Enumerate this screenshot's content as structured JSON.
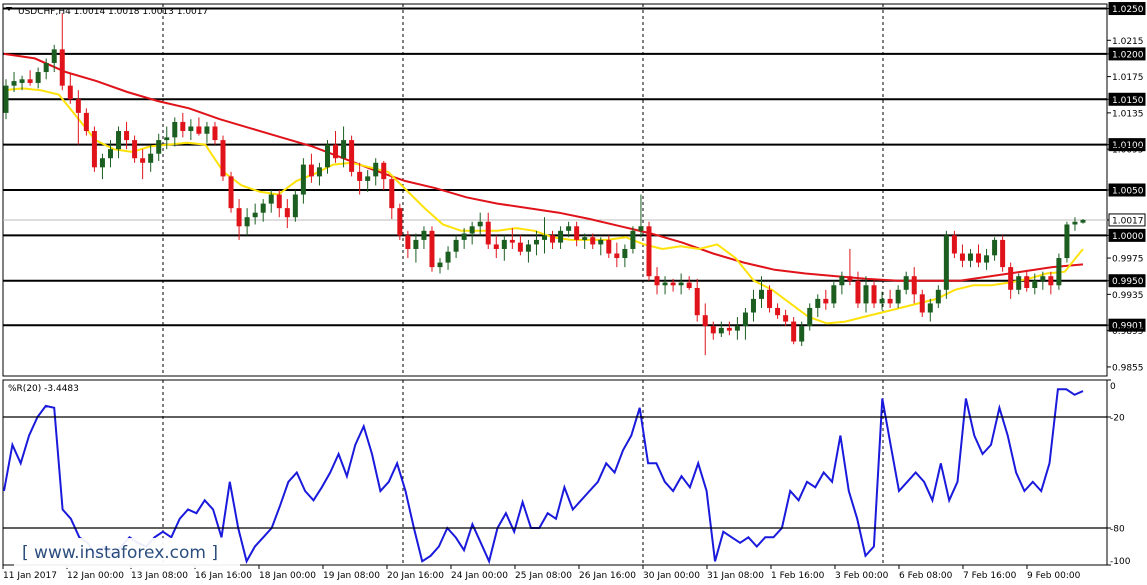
{
  "header": {
    "symbol_line": "USDCHF,H4  1.0014 1.0018 1.0013 1.0017"
  },
  "indicator": {
    "label": "%R(20) -3.4483"
  },
  "watermark": {
    "text": "[ www.instaforex.com ]"
  },
  "colors": {
    "bull": "#1b5e20",
    "bear": "#e0131a",
    "ma_fast": "#ffe20a",
    "ma_slow": "#e0131a",
    "wr": "#1a1adc",
    "level": "#000000"
  },
  "chart_data": [
    {
      "type": "candlestick",
      "title": "USDCHF,H4",
      "ohlc_header": {
        "open": 1.0014,
        "high": 1.0018,
        "low": 1.0013,
        "close": 1.0017
      },
      "ylim": [
        0.9845,
        1.0255
      ],
      "y_ticks": [
        "1.0250",
        "1.0215",
        "1.0200",
        "1.0175",
        "1.0150",
        "1.0135",
        "1.0100",
        "1.0095",
        "1.0050",
        "1.0017",
        "1.0000",
        "0.9975",
        "0.9950",
        "0.9935",
        "0.9901",
        "0.9895",
        "0.9855"
      ],
      "boxed_levels": [
        "1.0250",
        "1.0200",
        "1.0150",
        "1.0100",
        "1.0050",
        "1.0000",
        "0.9950",
        "0.9901"
      ],
      "current_price": "1.0017",
      "x_labels": [
        "11 Jan 2017",
        "12 Jan 00:00",
        "13 Jan 08:00",
        "16 Jan 16:00",
        "18 Jan 00:00",
        "19 Jan 08:00",
        "20 Jan 16:00",
        "24 Jan 00:00",
        "25 Jan 08:00",
        "26 Jan 16:00",
        "30 Jan 00:00",
        "31 Jan 08:00",
        "1 Feb 16:00",
        "3 Feb 00:00",
        "6 Feb 08:00",
        "7 Feb 16:00",
        "9 Feb 00:00"
      ],
      "candles": [
        [
          1.0135,
          1.0172,
          1.0128,
          1.0165
        ],
        [
          1.0165,
          1.018,
          1.0158,
          1.017
        ],
        [
          1.0168,
          1.0176,
          1.016,
          1.0172
        ],
        [
          1.0172,
          1.0182,
          1.0165,
          1.0168
        ],
        [
          1.0168,
          1.0185,
          1.0162,
          1.018
        ],
        [
          1.018,
          1.0195,
          1.0172,
          1.019
        ],
        [
          1.019,
          1.021,
          1.018,
          1.0205
        ],
        [
          1.0205,
          1.0245,
          1.016,
          1.0165
        ],
        [
          1.0165,
          1.0178,
          1.0145,
          1.015
        ],
        [
          1.015,
          1.016,
          1.01,
          1.0135
        ],
        [
          1.0135,
          1.014,
          1.011,
          1.0115
        ],
        [
          1.0115,
          1.012,
          1.007,
          1.0075
        ],
        [
          1.0075,
          1.009,
          1.0062,
          1.0085
        ],
        [
          1.0085,
          1.0105,
          1.0075,
          1.0095
        ],
        [
          1.0095,
          1.012,
          1.0085,
          1.0115
        ],
        [
          1.0115,
          1.0125,
          1.0095,
          1.0105
        ],
        [
          1.0105,
          1.011,
          1.008,
          1.0085
        ],
        [
          1.0085,
          1.0095,
          1.0062,
          1.008
        ],
        [
          1.008,
          1.01,
          1.007,
          1.009
        ],
        [
          1.009,
          1.0112,
          1.0082,
          1.0105
        ],
        [
          1.0105,
          1.012,
          1.0095,
          1.0108
        ],
        [
          1.0108,
          1.013,
          1.0098,
          1.0125
        ],
        [
          1.0125,
          1.0135,
          1.0108,
          1.0115
        ],
        [
          1.0115,
          1.0128,
          1.0105,
          1.012
        ],
        [
          1.012,
          1.013,
          1.011,
          1.0112
        ],
        [
          1.0112,
          1.0125,
          1.0102,
          1.012
        ],
        [
          1.012,
          1.0125,
          1.01,
          1.0105
        ],
        [
          1.0105,
          1.011,
          1.006,
          1.0065
        ],
        [
          1.0065,
          1.007,
          1.0025,
          1.003
        ],
        [
          1.003,
          1.004,
          0.9995,
          1.001
        ],
        [
          1.001,
          1.003,
          1.0,
          1.002
        ],
        [
          1.002,
          1.0035,
          1.0012,
          1.0025
        ],
        [
          1.0025,
          1.004,
          1.0015,
          1.0035
        ],
        [
          1.0035,
          1.005,
          1.0025,
          1.0045
        ],
        [
          1.0045,
          1.005,
          1.002,
          1.003
        ],
        [
          1.003,
          1.004,
          1.0008,
          1.002
        ],
        [
          1.002,
          1.005,
          1.0015,
          1.0045
        ],
        [
          1.0045,
          1.0085,
          1.0035,
          1.0078
        ],
        [
          1.0078,
          1.009,
          1.0058,
          1.0065
        ],
        [
          1.0065,
          1.008,
          1.0055,
          1.0075
        ],
        [
          1.0075,
          1.0105,
          1.0068,
          1.01
        ],
        [
          1.01,
          1.0115,
          1.008,
          1.0085
        ],
        [
          1.0085,
          1.012,
          1.0075,
          1.0105
        ],
        [
          1.0105,
          1.011,
          1.0065,
          1.007
        ],
        [
          1.007,
          1.008,
          1.0045,
          1.006
        ],
        [
          1.006,
          1.0072,
          1.0048,
          1.0065
        ],
        [
          1.0065,
          1.0085,
          1.0055,
          1.008
        ],
        [
          1.008,
          1.0082,
          1.005,
          1.0062
        ],
        [
          1.0062,
          1.0065,
          1.0018,
          1.003
        ],
        [
          1.003,
          1.0035,
          0.9995,
          1.0
        ],
        [
          1.0,
          1.0005,
          0.9975,
          0.9985
        ],
        [
          0.9985,
          1.0002,
          0.997,
          0.9995
        ],
        [
          0.9995,
          1.001,
          0.9985,
          1.0005
        ],
        [
          1.0005,
          1.001,
          0.996,
          0.9965
        ],
        [
          0.9965,
          0.9975,
          0.9958,
          0.997
        ],
        [
          0.997,
          0.9988,
          0.9962,
          0.9982
        ],
        [
          0.9982,
          1.0,
          0.9975,
          0.9995
        ],
        [
          0.9995,
          1.0008,
          0.9985,
          1.0002
        ],
        [
          1.0002,
          1.0015,
          0.999,
          1.001
        ],
        [
          1.001,
          1.0025,
          1.0,
          1.0015
        ],
        [
          1.0015,
          1.0025,
          0.9985,
          0.999
        ],
        [
          0.999,
          1.0,
          0.9975,
          0.9985
        ],
        [
          0.9985,
          1.0,
          0.9972,
          0.9995
        ],
        [
          0.9995,
          1.0008,
          0.9985,
          0.9992
        ],
        [
          0.9992,
          1.0,
          0.9978,
          0.9982
        ],
        [
          0.9982,
          0.9995,
          0.997,
          0.999
        ],
        [
          0.999,
          1.0005,
          0.9978,
          0.9995
        ],
        [
          0.9995,
          1.002,
          0.998,
          1.0
        ],
        [
          1.0,
          1.0005,
          0.9985,
          0.9992
        ],
        [
          0.9992,
          1.001,
          0.9985,
          1.0005
        ],
        [
          1.0005,
          1.0015,
          0.9998,
          1.001
        ],
        [
          1.001,
          1.0015,
          0.9988,
          0.9995
        ],
        [
          0.9995,
          1.0002,
          0.9985,
          0.9998
        ],
        [
          0.9998,
          1.0002,
          0.9985,
          0.999
        ],
        [
          0.999,
          0.9998,
          0.9978,
          0.9995
        ],
        [
          0.9995,
          1.0,
          0.9975,
          0.998
        ],
        [
          0.998,
          0.9992,
          0.9965,
          0.9975
        ],
        [
          0.9975,
          0.999,
          0.9965,
          0.9985
        ],
        [
          0.9985,
          1.001,
          0.998,
          1.0005
        ],
        [
          1.0005,
          1.0045,
          0.9998,
          1.001
        ],
        [
          1.001,
          1.0015,
          0.995,
          0.9955
        ],
        [
          0.9955,
          0.9965,
          0.9935,
          0.9945
        ],
        [
          0.9945,
          0.9955,
          0.9935,
          0.9948
        ],
        [
          0.9948,
          0.9952,
          0.9938,
          0.9945
        ],
        [
          0.9945,
          0.9958,
          0.9935,
          0.9948
        ],
        [
          0.9948,
          0.9955,
          0.994,
          0.9942
        ],
        [
          0.9942,
          0.9952,
          0.9905,
          0.9912
        ],
        [
          0.9912,
          0.9925,
          0.9868,
          0.99
        ],
        [
          0.99,
          0.9905,
          0.9885,
          0.9892
        ],
        [
          0.9892,
          0.9905,
          0.9888,
          0.9898
        ],
        [
          0.9898,
          0.9905,
          0.989,
          0.9895
        ],
        [
          0.9895,
          0.991,
          0.9885,
          0.99
        ],
        [
          0.99,
          0.992,
          0.9885,
          0.9915
        ],
        [
          0.9915,
          0.994,
          0.9905,
          0.993
        ],
        [
          0.993,
          0.9955,
          0.992,
          0.994
        ],
        [
          0.994,
          0.9945,
          0.9915,
          0.992
        ],
        [
          0.992,
          0.9925,
          0.9908,
          0.9912
        ],
        [
          0.9912,
          0.9918,
          0.99,
          0.9905
        ],
        [
          0.9905,
          0.991,
          0.988,
          0.9883
        ],
        [
          0.9883,
          0.9905,
          0.9878,
          0.99
        ],
        [
          0.99,
          0.9925,
          0.9895,
          0.992
        ],
        [
          0.992,
          0.9935,
          0.991,
          0.993
        ],
        [
          0.993,
          0.994,
          0.9918,
          0.9925
        ],
        [
          0.9925,
          0.995,
          0.992,
          0.9945
        ],
        [
          0.9945,
          0.996,
          0.9935,
          0.9955
        ],
        [
          0.9955,
          0.9985,
          0.9945,
          0.995
        ],
        [
          0.995,
          0.996,
          0.992,
          0.9925
        ],
        [
          0.9925,
          0.9955,
          0.9915,
          0.9945
        ],
        [
          0.9945,
          0.995,
          0.992,
          0.9925
        ],
        [
          0.9925,
          0.9938,
          0.9918,
          0.993
        ],
        [
          0.993,
          0.994,
          0.992,
          0.9925
        ],
        [
          0.9925,
          0.9945,
          0.992,
          0.994
        ],
        [
          0.994,
          0.996,
          0.9935,
          0.9955
        ],
        [
          0.9955,
          0.9965,
          0.9925,
          0.9935
        ],
        [
          0.9935,
          0.994,
          0.991,
          0.9915
        ],
        [
          0.9915,
          0.993,
          0.9905,
          0.9925
        ],
        [
          0.9925,
          0.9945,
          0.992,
          0.994
        ],
        [
          0.994,
          1.0005,
          0.993,
          1.0
        ],
        [
          1.0,
          1.0005,
          0.9975,
          0.998
        ],
        [
          0.998,
          0.999,
          0.9965,
          0.9972
        ],
        [
          0.9972,
          0.9985,
          0.9965,
          0.998
        ],
        [
          0.998,
          0.999,
          0.9965,
          0.997
        ],
        [
          0.997,
          0.9985,
          0.9962,
          0.9978
        ],
        [
          0.9978,
          0.9998,
          0.9972,
          0.9995
        ],
        [
          0.9995,
          1.0,
          0.996,
          0.9965
        ],
        [
          0.9965,
          0.997,
          0.993,
          0.994
        ],
        [
          0.994,
          0.9958,
          0.9935,
          0.9955
        ],
        [
          0.9955,
          0.9962,
          0.9938,
          0.9942
        ],
        [
          0.9942,
          0.9958,
          0.9935,
          0.995
        ],
        [
          0.995,
          0.996,
          0.994,
          0.9955
        ],
        [
          0.9955,
          0.996,
          0.9935,
          0.9945
        ],
        [
          0.9945,
          0.998,
          0.994,
          0.9975
        ],
        [
          0.9975,
          1.0015,
          0.997,
          1.0012
        ],
        [
          1.0012,
          1.002,
          1.0005,
          1.0015
        ],
        [
          1.0014,
          1.0018,
          1.0013,
          1.0017
        ]
      ],
      "ma_fast": {
        "period_label": "",
        "values": [
          1.016,
          1.0162,
          1.016,
          1.0155,
          1.013,
          1.0105,
          1.0095,
          1.0092,
          1.0098,
          1.01,
          1.0102,
          1.01,
          1.007,
          1.0055,
          1.0048,
          1.0045,
          1.006,
          1.0068,
          1.0078,
          1.008,
          1.0075,
          1.007,
          1.005,
          1.003,
          1.0012,
          1.0005,
          1.0005,
          1.0005,
          1.0008,
          1.0005,
          0.9998,
          0.9995,
          0.9995,
          0.9995,
          0.9998,
          0.999,
          0.9985,
          0.9988,
          0.9985,
          0.999,
          0.9975,
          0.995,
          0.994,
          0.9925,
          0.991,
          0.9903,
          0.9905,
          0.991,
          0.9915,
          0.992,
          0.9925,
          0.993,
          0.994,
          0.9945,
          0.9945,
          0.9948,
          0.9952,
          0.9958,
          0.996,
          0.9985
        ]
      },
      "ma_slow": {
        "period_label": "",
        "values": [
          1.02,
          1.0195,
          1.018,
          1.017,
          1.0158,
          1.0148,
          1.014,
          1.0128,
          1.0118,
          1.0108,
          1.0098,
          1.0085,
          1.0072,
          1.006,
          1.0052,
          1.0042,
          1.0035,
          1.003,
          1.0025,
          1.0018,
          1.001,
          1.0002,
          0.9992,
          0.998,
          0.997,
          0.9962,
          0.9958,
          0.9955,
          0.9952,
          0.995,
          0.995,
          0.995,
          0.9955,
          0.996,
          0.9965,
          0.9968
        ]
      }
    },
    {
      "type": "line",
      "title": "%R(20) -3.4483",
      "ylim": [
        -100,
        0
      ],
      "y_ticks": [
        "0",
        "-20",
        "-80",
        "-100"
      ],
      "levels": [
        -20,
        -80
      ],
      "series": [
        {
          "values": [
            -60,
            -35,
            -45,
            -30,
            -20,
            -14,
            -15,
            -70,
            -75,
            -85,
            -88,
            -95,
            -90,
            -95,
            -90,
            -85,
            -88,
            -90,
            -85,
            -82,
            -85,
            -75,
            -70,
            -72,
            -65,
            -70,
            -85,
            -55,
            -80,
            -98,
            -90,
            -85,
            -80,
            -68,
            -55,
            -50,
            -60,
            -65,
            -58,
            -50,
            -40,
            -52,
            -35,
            -25,
            -40,
            -60,
            -55,
            -45,
            -60,
            -80,
            -98,
            -95,
            -90,
            -80,
            -85,
            -92,
            -78,
            -88,
            -98,
            -80,
            -72,
            -82,
            -66,
            -80,
            -80,
            -72,
            -75,
            -58,
            -70,
            -65,
            -60,
            -55,
            -45,
            -50,
            -38,
            -30,
            -15,
            -45,
            -45,
            -55,
            -60,
            -52,
            -58,
            -45,
            -60,
            -98,
            -82,
            -85,
            -88,
            -85,
            -90,
            -85,
            -85,
            -80,
            -60,
            -65,
            -55,
            -58,
            -50,
            -55,
            -30,
            -60,
            -75,
            -95,
            -90,
            -10,
            -35,
            -60,
            -55,
            -50,
            -55,
            -65,
            -45,
            -65,
            -55,
            -10,
            -30,
            -40,
            -35,
            -15,
            -30,
            -50,
            -60,
            -55,
            -60,
            -45,
            -5,
            -5,
            -8,
            -6
          ]
        }
      ]
    }
  ]
}
